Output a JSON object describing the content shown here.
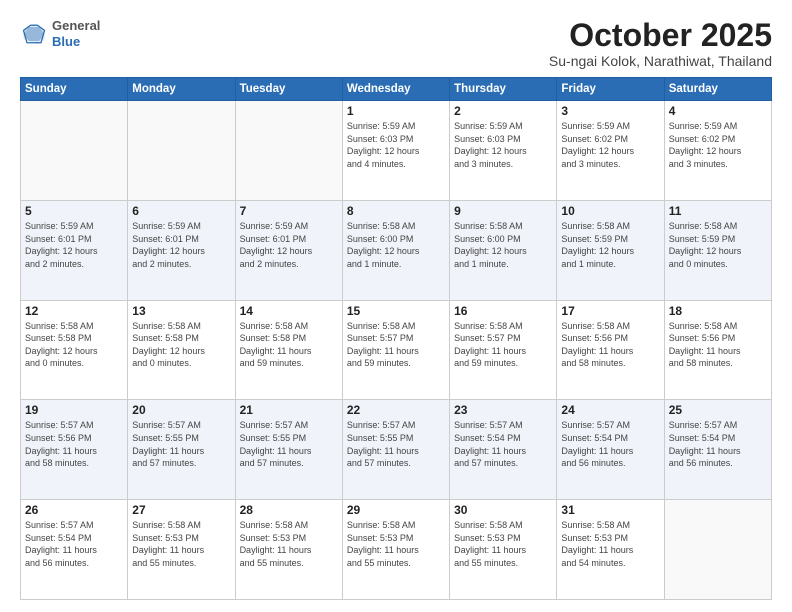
{
  "logo": {
    "general": "General",
    "blue": "Blue"
  },
  "header": {
    "month": "October 2025",
    "location": "Su-ngai Kolok, Narathiwat, Thailand"
  },
  "weekdays": [
    "Sunday",
    "Monday",
    "Tuesday",
    "Wednesday",
    "Thursday",
    "Friday",
    "Saturday"
  ],
  "weeks": [
    [
      {
        "day": "",
        "info": ""
      },
      {
        "day": "",
        "info": ""
      },
      {
        "day": "",
        "info": ""
      },
      {
        "day": "1",
        "info": "Sunrise: 5:59 AM\nSunset: 6:03 PM\nDaylight: 12 hours\nand 4 minutes."
      },
      {
        "day": "2",
        "info": "Sunrise: 5:59 AM\nSunset: 6:03 PM\nDaylight: 12 hours\nand 3 minutes."
      },
      {
        "day": "3",
        "info": "Sunrise: 5:59 AM\nSunset: 6:02 PM\nDaylight: 12 hours\nand 3 minutes."
      },
      {
        "day": "4",
        "info": "Sunrise: 5:59 AM\nSunset: 6:02 PM\nDaylight: 12 hours\nand 3 minutes."
      }
    ],
    [
      {
        "day": "5",
        "info": "Sunrise: 5:59 AM\nSunset: 6:01 PM\nDaylight: 12 hours\nand 2 minutes."
      },
      {
        "day": "6",
        "info": "Sunrise: 5:59 AM\nSunset: 6:01 PM\nDaylight: 12 hours\nand 2 minutes."
      },
      {
        "day": "7",
        "info": "Sunrise: 5:59 AM\nSunset: 6:01 PM\nDaylight: 12 hours\nand 2 minutes."
      },
      {
        "day": "8",
        "info": "Sunrise: 5:58 AM\nSunset: 6:00 PM\nDaylight: 12 hours\nand 1 minute."
      },
      {
        "day": "9",
        "info": "Sunrise: 5:58 AM\nSunset: 6:00 PM\nDaylight: 12 hours\nand 1 minute."
      },
      {
        "day": "10",
        "info": "Sunrise: 5:58 AM\nSunset: 5:59 PM\nDaylight: 12 hours\nand 1 minute."
      },
      {
        "day": "11",
        "info": "Sunrise: 5:58 AM\nSunset: 5:59 PM\nDaylight: 12 hours\nand 0 minutes."
      }
    ],
    [
      {
        "day": "12",
        "info": "Sunrise: 5:58 AM\nSunset: 5:58 PM\nDaylight: 12 hours\nand 0 minutes."
      },
      {
        "day": "13",
        "info": "Sunrise: 5:58 AM\nSunset: 5:58 PM\nDaylight: 12 hours\nand 0 minutes."
      },
      {
        "day": "14",
        "info": "Sunrise: 5:58 AM\nSunset: 5:58 PM\nDaylight: 11 hours\nand 59 minutes."
      },
      {
        "day": "15",
        "info": "Sunrise: 5:58 AM\nSunset: 5:57 PM\nDaylight: 11 hours\nand 59 minutes."
      },
      {
        "day": "16",
        "info": "Sunrise: 5:58 AM\nSunset: 5:57 PM\nDaylight: 11 hours\nand 59 minutes."
      },
      {
        "day": "17",
        "info": "Sunrise: 5:58 AM\nSunset: 5:56 PM\nDaylight: 11 hours\nand 58 minutes."
      },
      {
        "day": "18",
        "info": "Sunrise: 5:58 AM\nSunset: 5:56 PM\nDaylight: 11 hours\nand 58 minutes."
      }
    ],
    [
      {
        "day": "19",
        "info": "Sunrise: 5:57 AM\nSunset: 5:56 PM\nDaylight: 11 hours\nand 58 minutes."
      },
      {
        "day": "20",
        "info": "Sunrise: 5:57 AM\nSunset: 5:55 PM\nDaylight: 11 hours\nand 57 minutes."
      },
      {
        "day": "21",
        "info": "Sunrise: 5:57 AM\nSunset: 5:55 PM\nDaylight: 11 hours\nand 57 minutes."
      },
      {
        "day": "22",
        "info": "Sunrise: 5:57 AM\nSunset: 5:55 PM\nDaylight: 11 hours\nand 57 minutes."
      },
      {
        "day": "23",
        "info": "Sunrise: 5:57 AM\nSunset: 5:54 PM\nDaylight: 11 hours\nand 57 minutes."
      },
      {
        "day": "24",
        "info": "Sunrise: 5:57 AM\nSunset: 5:54 PM\nDaylight: 11 hours\nand 56 minutes."
      },
      {
        "day": "25",
        "info": "Sunrise: 5:57 AM\nSunset: 5:54 PM\nDaylight: 11 hours\nand 56 minutes."
      }
    ],
    [
      {
        "day": "26",
        "info": "Sunrise: 5:57 AM\nSunset: 5:54 PM\nDaylight: 11 hours\nand 56 minutes."
      },
      {
        "day": "27",
        "info": "Sunrise: 5:58 AM\nSunset: 5:53 PM\nDaylight: 11 hours\nand 55 minutes."
      },
      {
        "day": "28",
        "info": "Sunrise: 5:58 AM\nSunset: 5:53 PM\nDaylight: 11 hours\nand 55 minutes."
      },
      {
        "day": "29",
        "info": "Sunrise: 5:58 AM\nSunset: 5:53 PM\nDaylight: 11 hours\nand 55 minutes."
      },
      {
        "day": "30",
        "info": "Sunrise: 5:58 AM\nSunset: 5:53 PM\nDaylight: 11 hours\nand 55 minutes."
      },
      {
        "day": "31",
        "info": "Sunrise: 5:58 AM\nSunset: 5:53 PM\nDaylight: 11 hours\nand 54 minutes."
      },
      {
        "day": "",
        "info": ""
      }
    ]
  ]
}
